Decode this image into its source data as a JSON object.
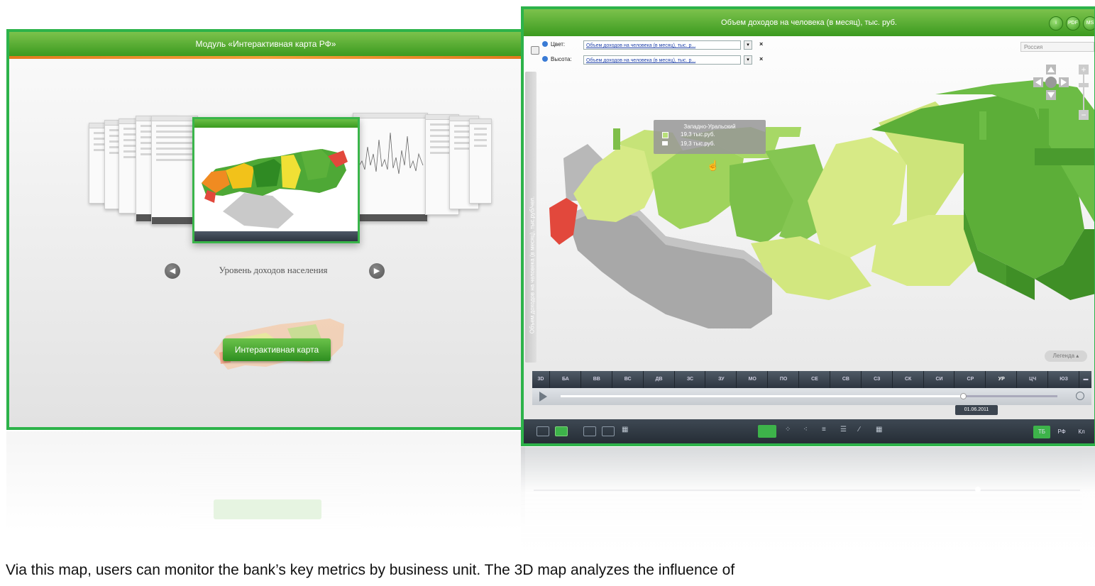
{
  "left_panel": {
    "title": "Модуль «Интерактивная карта РФ»",
    "carousel_caption": "Уровень доходов населения",
    "prev_icon": "◀",
    "next_icon": "▶",
    "button_label": "Интерактивная карта"
  },
  "right_panel": {
    "title": "Объем доходов на человека (в месяц), тыс. руб.",
    "header_icons": [
      "i",
      "PDF",
      "MS"
    ],
    "color_label": "Цвет:",
    "color_value": "Объем доходов на человека (в месяц), тыс. р...",
    "height_label": "Высота:",
    "height_value": "Объем доходов на человека (в месяц), тыс. р...",
    "clear_icon": "×",
    "region_select": "Россия",
    "axis_label": "Объем доходов на человека (в месяц), тыс.руб/чел.",
    "tooltip": {
      "region": "Западно-Уральский",
      "color_value": "19,3 тыс.руб.",
      "height_value": "19,3 тыс.руб."
    },
    "legend_label": "Легенда ▴",
    "tabs": [
      "БА",
      "ВВ",
      "ВС",
      "ДВ",
      "ЗС",
      "ЗУ",
      "МО",
      "ПО",
      "СЕ",
      "СВ",
      "СЗ",
      "СК",
      "СИ",
      "СР",
      "УР",
      "ЦЧ",
      "ЮЗ"
    ],
    "active_tab": "УР",
    "mode_3d": "3D",
    "timeline_date": "01.06.2011",
    "timeline_progress": 0.81,
    "lang_buttons": [
      "ТБ",
      "РФ",
      "Кл"
    ],
    "active_lang": "ТБ"
  },
  "caption": "Via this map, users can monitor the bank’s key metrics by business unit. The 3D map analyzes the influence of",
  "colors": {
    "frame_green": "#2db34a",
    "header_green": "#3b9a1f",
    "dark_bar": "#2d3540",
    "region_red": "#e2483c",
    "region_light": "#d7ea86",
    "region_mid": "#9fd35c",
    "region_dark": "#5cae38",
    "region_grey": "#b8b8b8"
  }
}
